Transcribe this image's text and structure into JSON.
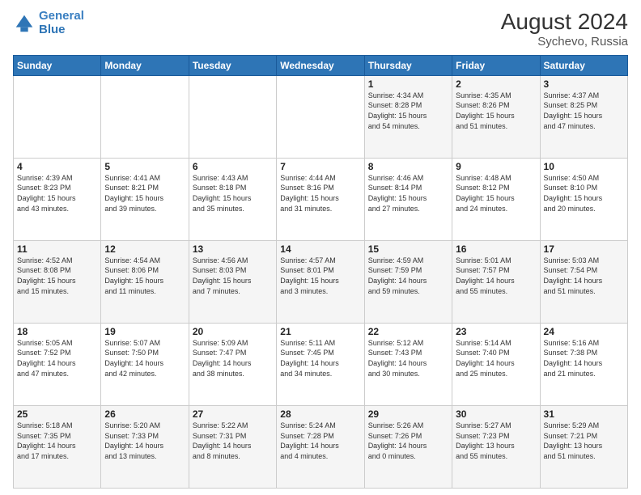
{
  "logo": {
    "line1": "General",
    "line2": "Blue"
  },
  "title": "August 2024",
  "subtitle": "Sychevo, Russia",
  "days_of_week": [
    "Sunday",
    "Monday",
    "Tuesday",
    "Wednesday",
    "Thursday",
    "Friday",
    "Saturday"
  ],
  "weeks": [
    [
      {
        "day": "",
        "info": ""
      },
      {
        "day": "",
        "info": ""
      },
      {
        "day": "",
        "info": ""
      },
      {
        "day": "",
        "info": ""
      },
      {
        "day": "1",
        "info": "Sunrise: 4:34 AM\nSunset: 8:28 PM\nDaylight: 15 hours\nand 54 minutes."
      },
      {
        "day": "2",
        "info": "Sunrise: 4:35 AM\nSunset: 8:26 PM\nDaylight: 15 hours\nand 51 minutes."
      },
      {
        "day": "3",
        "info": "Sunrise: 4:37 AM\nSunset: 8:25 PM\nDaylight: 15 hours\nand 47 minutes."
      }
    ],
    [
      {
        "day": "4",
        "info": "Sunrise: 4:39 AM\nSunset: 8:23 PM\nDaylight: 15 hours\nand 43 minutes."
      },
      {
        "day": "5",
        "info": "Sunrise: 4:41 AM\nSunset: 8:21 PM\nDaylight: 15 hours\nand 39 minutes."
      },
      {
        "day": "6",
        "info": "Sunrise: 4:43 AM\nSunset: 8:18 PM\nDaylight: 15 hours\nand 35 minutes."
      },
      {
        "day": "7",
        "info": "Sunrise: 4:44 AM\nSunset: 8:16 PM\nDaylight: 15 hours\nand 31 minutes."
      },
      {
        "day": "8",
        "info": "Sunrise: 4:46 AM\nSunset: 8:14 PM\nDaylight: 15 hours\nand 27 minutes."
      },
      {
        "day": "9",
        "info": "Sunrise: 4:48 AM\nSunset: 8:12 PM\nDaylight: 15 hours\nand 24 minutes."
      },
      {
        "day": "10",
        "info": "Sunrise: 4:50 AM\nSunset: 8:10 PM\nDaylight: 15 hours\nand 20 minutes."
      }
    ],
    [
      {
        "day": "11",
        "info": "Sunrise: 4:52 AM\nSunset: 8:08 PM\nDaylight: 15 hours\nand 15 minutes."
      },
      {
        "day": "12",
        "info": "Sunrise: 4:54 AM\nSunset: 8:06 PM\nDaylight: 15 hours\nand 11 minutes."
      },
      {
        "day": "13",
        "info": "Sunrise: 4:56 AM\nSunset: 8:03 PM\nDaylight: 15 hours\nand 7 minutes."
      },
      {
        "day": "14",
        "info": "Sunrise: 4:57 AM\nSunset: 8:01 PM\nDaylight: 15 hours\nand 3 minutes."
      },
      {
        "day": "15",
        "info": "Sunrise: 4:59 AM\nSunset: 7:59 PM\nDaylight: 14 hours\nand 59 minutes."
      },
      {
        "day": "16",
        "info": "Sunrise: 5:01 AM\nSunset: 7:57 PM\nDaylight: 14 hours\nand 55 minutes."
      },
      {
        "day": "17",
        "info": "Sunrise: 5:03 AM\nSunset: 7:54 PM\nDaylight: 14 hours\nand 51 minutes."
      }
    ],
    [
      {
        "day": "18",
        "info": "Sunrise: 5:05 AM\nSunset: 7:52 PM\nDaylight: 14 hours\nand 47 minutes."
      },
      {
        "day": "19",
        "info": "Sunrise: 5:07 AM\nSunset: 7:50 PM\nDaylight: 14 hours\nand 42 minutes."
      },
      {
        "day": "20",
        "info": "Sunrise: 5:09 AM\nSunset: 7:47 PM\nDaylight: 14 hours\nand 38 minutes."
      },
      {
        "day": "21",
        "info": "Sunrise: 5:11 AM\nSunset: 7:45 PM\nDaylight: 14 hours\nand 34 minutes."
      },
      {
        "day": "22",
        "info": "Sunrise: 5:12 AM\nSunset: 7:43 PM\nDaylight: 14 hours\nand 30 minutes."
      },
      {
        "day": "23",
        "info": "Sunrise: 5:14 AM\nSunset: 7:40 PM\nDaylight: 14 hours\nand 25 minutes."
      },
      {
        "day": "24",
        "info": "Sunrise: 5:16 AM\nSunset: 7:38 PM\nDaylight: 14 hours\nand 21 minutes."
      }
    ],
    [
      {
        "day": "25",
        "info": "Sunrise: 5:18 AM\nSunset: 7:35 PM\nDaylight: 14 hours\nand 17 minutes."
      },
      {
        "day": "26",
        "info": "Sunrise: 5:20 AM\nSunset: 7:33 PM\nDaylight: 14 hours\nand 13 minutes."
      },
      {
        "day": "27",
        "info": "Sunrise: 5:22 AM\nSunset: 7:31 PM\nDaylight: 14 hours\nand 8 minutes."
      },
      {
        "day": "28",
        "info": "Sunrise: 5:24 AM\nSunset: 7:28 PM\nDaylight: 14 hours\nand 4 minutes."
      },
      {
        "day": "29",
        "info": "Sunrise: 5:26 AM\nSunset: 7:26 PM\nDaylight: 14 hours\nand 0 minutes."
      },
      {
        "day": "30",
        "info": "Sunrise: 5:27 AM\nSunset: 7:23 PM\nDaylight: 13 hours\nand 55 minutes."
      },
      {
        "day": "31",
        "info": "Sunrise: 5:29 AM\nSunset: 7:21 PM\nDaylight: 13 hours\nand 51 minutes."
      }
    ]
  ]
}
